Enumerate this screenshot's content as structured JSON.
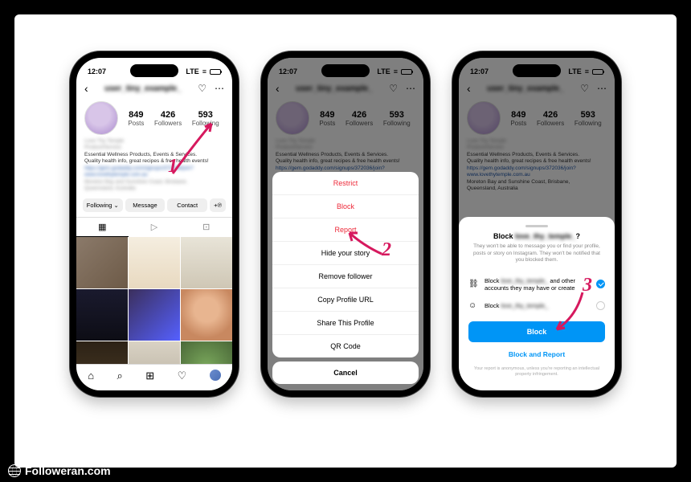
{
  "watermark": "Followeran.com",
  "status": {
    "time": "12:07",
    "net": "LTE"
  },
  "profile": {
    "username_blur": "user_tiny_example_",
    "name_blur": "Love Thy Temple",
    "category_blur": "Product/Service",
    "stats": {
      "posts": "849",
      "followers": "426",
      "following": "593",
      "posts_l": "Posts",
      "followers_l": "Followers",
      "following_l": "Following"
    },
    "bio1": "Essential Wellness Products, Events & Services.",
    "bio2": "Quality health info, great recipes & free health events!",
    "bio3_blur": "https://gem.godaddy.com/signups/372036/join?",
    "bio4_blur": "www.lovethytemple.com.au",
    "bio5_blur": "Moreton Bay and Sunshine Coast, Brisbane,",
    "bio6_blur": "Queensland, Australia",
    "actions": {
      "following": "Following ⌄",
      "message": "Message",
      "contact": "Contact",
      "suggest": "+℗"
    }
  },
  "menu": {
    "restrict": "Restrict",
    "block": "Block",
    "report": "Report",
    "hide": "Hide your story",
    "remove": "Remove follower",
    "copy": "Copy Profile URL",
    "share": "Share This Profile",
    "qr": "QR Code",
    "cancel": "Cancel"
  },
  "block": {
    "title_pre": "Block",
    "title_blur": "love_thy_temple_",
    "title_q": "?",
    "explain": "They won't be able to message you or find your profile, posts or story on Instagram. They won't be notified that you blocked them.",
    "opt1a": "Block",
    "opt1blur": "love_thy_temple_",
    "opt1b": "and other accounts they may have or create",
    "opt2a": "Block",
    "opt2blur": "love_thy_temple_",
    "btn": "Block",
    "bar": "Block and Report",
    "disc": "Your report is anonymous, unless you're reporting an intellectual property infringement."
  },
  "nums": {
    "n1": "1",
    "n2": "2",
    "n3": "3"
  }
}
